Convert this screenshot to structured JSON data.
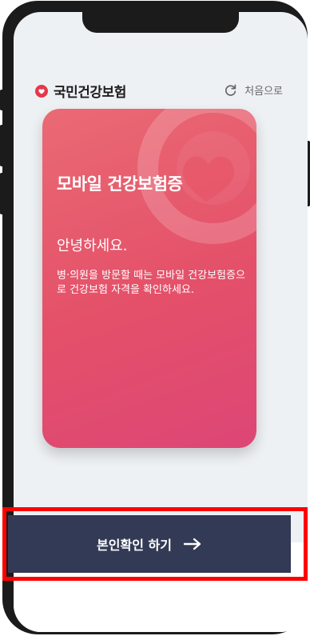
{
  "header": {
    "brand": "국민건강보험",
    "restart_label": "처음으로"
  },
  "card": {
    "title": "모바일 건강보험증",
    "greeting": "안녕하세요.",
    "description": "병·의원을 방문할 때는 모바일 건강보험증으로 건강보험 자격을 확인하세요."
  },
  "footer": {
    "action_label": "본인확인 하기"
  },
  "colors": {
    "brand_red": "#e5384a",
    "card_gradient_start": "#ea6a74",
    "card_gradient_end": "#dd4676",
    "action_bg": "#323a55",
    "highlight": "#ff0000"
  },
  "icons": [
    "heart-logo-icon",
    "refresh-icon",
    "arrow-right-icon"
  ]
}
